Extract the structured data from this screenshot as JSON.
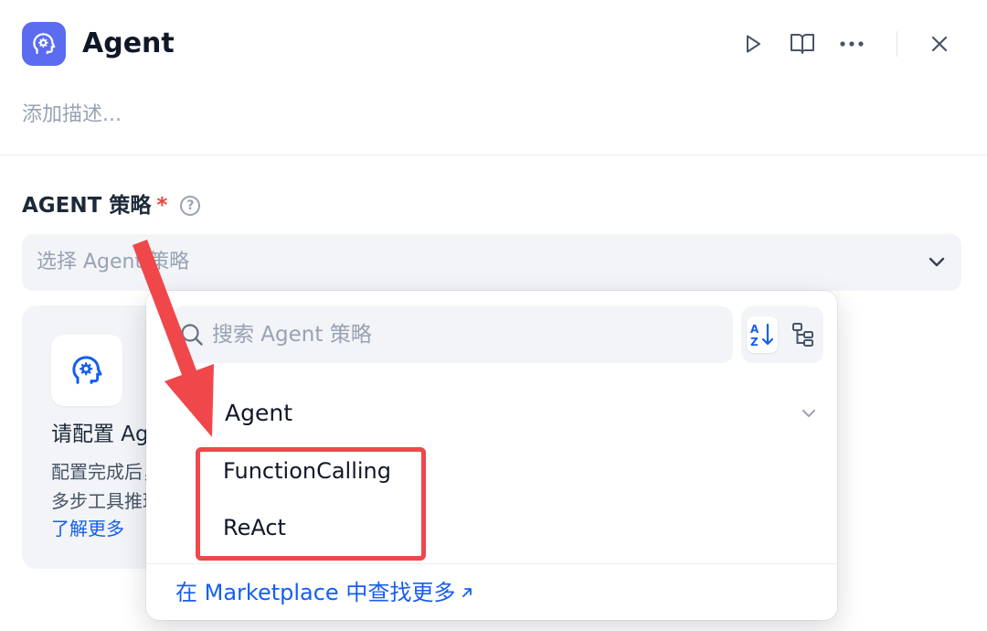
{
  "header": {
    "title": "Agent",
    "description_placeholder": "添加描述..."
  },
  "field": {
    "label": "AGENT 策略",
    "required_mark": "*",
    "help_glyph": "?",
    "select_placeholder": "选择 Agent 策略"
  },
  "card": {
    "title": "请配置 Agent 策略。",
    "description_line1": "配置完成后，此节点将自动加载其余配置。策略将影响",
    "description_line2": "多步工具推理的机制。",
    "link": "了解更多"
  },
  "dropdown": {
    "search_placeholder": "搜索 Agent 策略",
    "group_label": "Agent",
    "options": [
      {
        "label": "FunctionCalling"
      },
      {
        "label": "ReAct"
      }
    ],
    "marketplace_link": "在 Marketplace 中查找更多"
  },
  "colors": {
    "accent": "#155eef",
    "brand_icon_bg": "#5b6cf0",
    "annotation_red": "#f0474a",
    "required": "#f04438"
  }
}
